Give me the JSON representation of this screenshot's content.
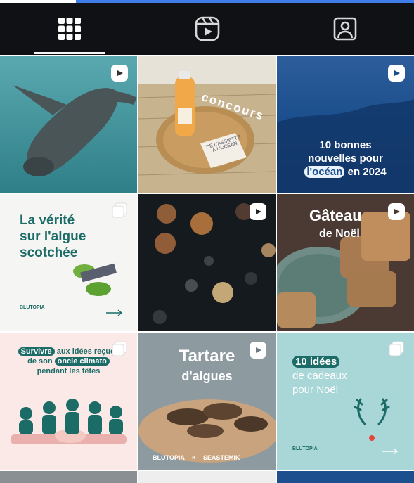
{
  "tabs": [
    {
      "name": "grid-icon",
      "active": true
    },
    {
      "name": "reels-icon",
      "active": false
    },
    {
      "name": "tagged-icon",
      "active": false
    }
  ],
  "posts": [
    {
      "id": "post-seal",
      "kind": "reel",
      "scene": "seal-underwater"
    },
    {
      "id": "post-concours",
      "kind": "image",
      "scene": "juice-bottle-book",
      "curved_text": "concours",
      "book_text": "DE L'ASSIETTE À L'OCÉAN"
    },
    {
      "id": "post-ocean-news",
      "kind": "reel",
      "line1": "10 bonnes",
      "line2": "nouvelles pour",
      "highlight": "l'océan",
      "line3_rest": "en 2024"
    },
    {
      "id": "post-algue",
      "kind": "carousel",
      "line1": "La vérité",
      "line2": "sur l'algue",
      "line3": "scotchée",
      "logo": "BLUTOPIA"
    },
    {
      "id": "post-bokeh",
      "kind": "reel",
      "scene": "bokeh-lights"
    },
    {
      "id": "post-gateau",
      "kind": "reel",
      "line1": "Gâteau",
      "line2": "de Noël"
    },
    {
      "id": "post-survivre",
      "kind": "carousel",
      "highlight1": "Survivre",
      "rest1": "aux idées reçues",
      "pre2": "de son",
      "highlight2": "oncle climato",
      "line3": "pendant les fêtes"
    },
    {
      "id": "post-tartare",
      "kind": "reel",
      "line1": "Tartare",
      "line2": "d'algues",
      "brand1": "BLUTOPIA",
      "sep": "×",
      "brand2": "SEASTEMIK"
    },
    {
      "id": "post-cadeaux",
      "kind": "carousel",
      "highlight": "10 idées",
      "line2": "de cadeaux",
      "line3": "pour Noël",
      "logo": "BLUTOPIA"
    }
  ],
  "colors": {
    "tabbar": "#0f1114",
    "accent_teal": "#1b6b66",
    "ocean_blue": "#1c4f8d"
  }
}
